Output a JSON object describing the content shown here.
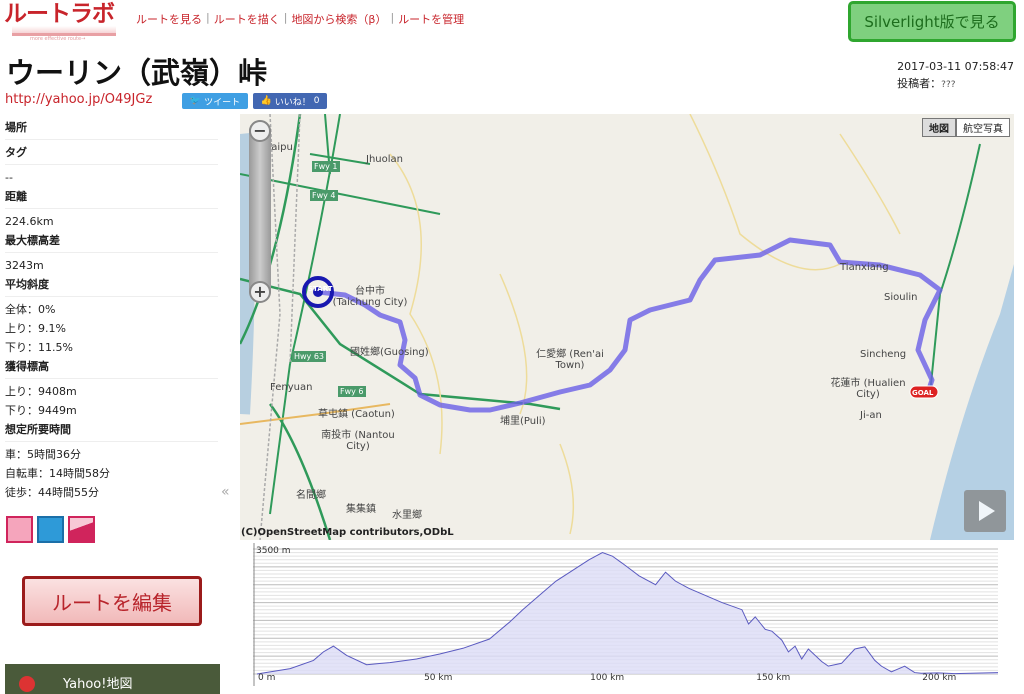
{
  "logo": {
    "text": "ルートラボ",
    "tagline": "more effective route→"
  },
  "nav": [
    "ルートを見る",
    "ルートを描く",
    "地図から検索（β）",
    "ルートを管理"
  ],
  "silverlight": "Silverlight版で見る",
  "title": "ウーリン（武嶺）峠",
  "meta": {
    "datetime": "2017-03-11 07:58:47",
    "poster_label": "投稿者：",
    "poster": "???"
  },
  "share": {
    "url": "http://yahoo.jp/O49JGz",
    "tweet": "ツイート",
    "like": "いいね！",
    "like_count": "0"
  },
  "sidebar": [
    {
      "h": "場所",
      "v": []
    },
    {
      "h": "タグ",
      "v": [
        "--"
      ]
    },
    {
      "h": "距離",
      "v": [
        "224.6km"
      ]
    },
    {
      "h": "最大標高差",
      "v": [
        "3243m"
      ]
    },
    {
      "h": "平均斜度",
      "v": [
        "全体：0%",
        "上り：9.1%",
        "下り：11.5%"
      ]
    },
    {
      "h": "獲得標高",
      "v": [
        "上り：9408m",
        "下り：9449m"
      ]
    },
    {
      "h": "想定所要時間",
      "v": [
        "車：5時間36分",
        "自転車：14時間58分",
        "徒歩：44時間55分"
      ]
    }
  ],
  "collapse_icon": "«",
  "edit_button": "ルートを編集",
  "yahoo_banner": "Yahoo!地図",
  "map": {
    "types": [
      "地図",
      "航空写真"
    ],
    "active_type": "地図",
    "zoom_in": "+",
    "zoom_out": "−",
    "copyright": "(C)OpenStreetMap contributors,ODbL",
    "start_label": "START",
    "goal_label": "GOAL",
    "route_color": "#6a5fe6",
    "labels": [
      "Waipu",
      "Jhuolan",
      "台中市 (Taichung City)",
      "國姓鄉(Guosing)",
      "仁愛鄉 (Ren'ai Town)",
      "Fenyuan",
      "草屯鎮 (Caotun)",
      "南投市 (Nantou City)",
      "埔里(Puli)",
      "名間鄉",
      "集集鎮",
      "水里鄉",
      "Tianxiang",
      "Sioulin",
      "Sincheng",
      "花蓮市 (Hualien City)",
      "Ji-an",
      "Fwy 1",
      "Fwy 4",
      "Hwy 63",
      "Fwy 6"
    ]
  },
  "chart_data": {
    "type": "area",
    "xlabel": "",
    "ylabel": "",
    "xlim": [
      0,
      224.6
    ],
    "ylim": [
      0,
      3500
    ],
    "x_ticks": [
      "0 m",
      "50 km",
      "100 km",
      "150 km",
      "200 km"
    ],
    "y_ticks": [
      "3500 m"
    ],
    "grid": true,
    "x": [
      0,
      10,
      17,
      20,
      23,
      27,
      33,
      40,
      48,
      55,
      62,
      70,
      76,
      80,
      85,
      90,
      95,
      100,
      104,
      107,
      110,
      115,
      120,
      123,
      126,
      130,
      135,
      140,
      146,
      148,
      150,
      153,
      155,
      158,
      160,
      162,
      164,
      166,
      170,
      172,
      176,
      180,
      183,
      186,
      188,
      191,
      195,
      198,
      200,
      205,
      210,
      224.6
    ],
    "y": [
      0,
      150,
      380,
      620,
      780,
      520,
      260,
      320,
      420,
      560,
      720,
      980,
      1450,
      1800,
      2200,
      2600,
      2900,
      3200,
      3400,
      3300,
      3100,
      2750,
      2500,
      2850,
      2600,
      2400,
      2200,
      2000,
      1800,
      1400,
      1600,
      1250,
      1200,
      950,
      620,
      780,
      420,
      700,
      350,
      220,
      300,
      700,
      760,
      380,
      220,
      60,
      220,
      40,
      20,
      30,
      10,
      40
    ]
  },
  "colors": {
    "brand": "#c8242b",
    "silverlight": "#2fa62f",
    "route": "#6a5fe6",
    "elev_fill": "#dcdcf6"
  }
}
